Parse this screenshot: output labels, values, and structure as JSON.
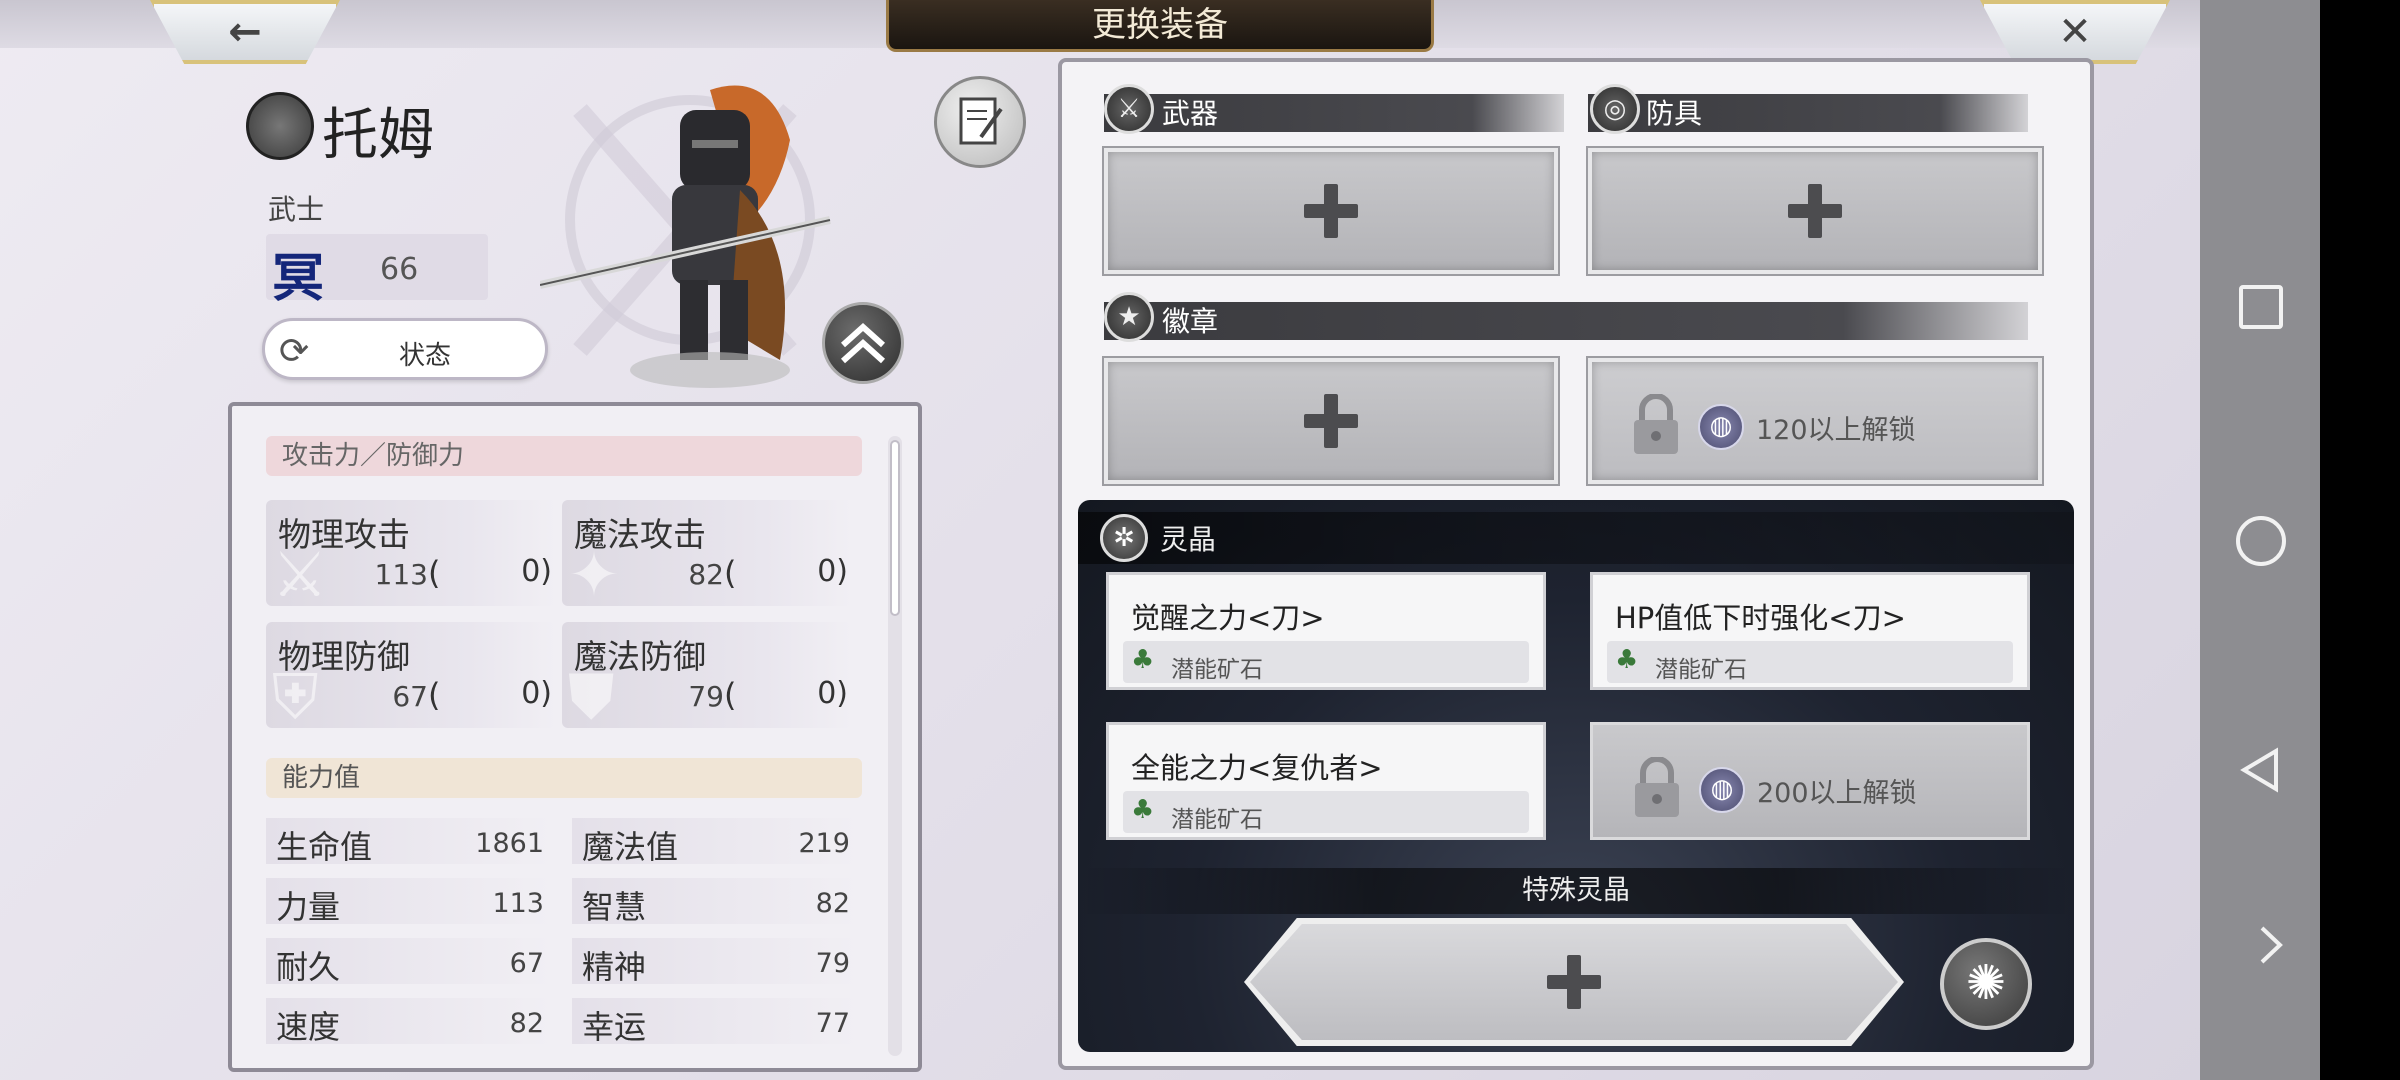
{
  "header": {
    "title": "更换装备",
    "back_icon": "←",
    "close_icon": "✕"
  },
  "character": {
    "name": "托姆",
    "class": "武士",
    "rank_glyph": "冥",
    "level": "66",
    "status_button": "状态",
    "status_icon": "⟳"
  },
  "stats": {
    "atk_def_header": "攻击力／防御力",
    "cards": [
      {
        "label": "物理攻击",
        "value": "113",
        "bonus": "0)",
        "open": "("
      },
      {
        "label": "魔法攻击",
        "value": "82",
        "bonus": "0)",
        "open": "("
      },
      {
        "label": "物理防御",
        "value": "67",
        "bonus": "0)",
        "open": "("
      },
      {
        "label": "魔法防御",
        "value": "79",
        "bonus": "0)",
        "open": "("
      }
    ],
    "ability_header": "能力值",
    "abilities": [
      {
        "name": "生命值",
        "value": "1861"
      },
      {
        "name": "魔法值",
        "value": "219"
      },
      {
        "name": "力量",
        "value": "113"
      },
      {
        "name": "智慧",
        "value": "82"
      },
      {
        "name": "耐久",
        "value": "67"
      },
      {
        "name": "精神",
        "value": "79"
      },
      {
        "name": "速度",
        "value": "82"
      },
      {
        "name": "幸运",
        "value": "77"
      }
    ]
  },
  "equipment": {
    "weapon_label": "武器",
    "armor_label": "防具",
    "badge_label": "徽章",
    "badge_lock_text": "120以上解锁",
    "crystal_label": "灵晶",
    "crystals": [
      {
        "name": "觉醒之力<刀>",
        "material": "潜能矿石"
      },
      {
        "name": "HP值低下时强化<刀>",
        "material": "潜能矿石"
      },
      {
        "name": "全能之力<复仇者>",
        "material": "潜能矿石"
      }
    ],
    "crystal_lock_text": "200以上解锁",
    "special_label": "特殊灵晶"
  }
}
